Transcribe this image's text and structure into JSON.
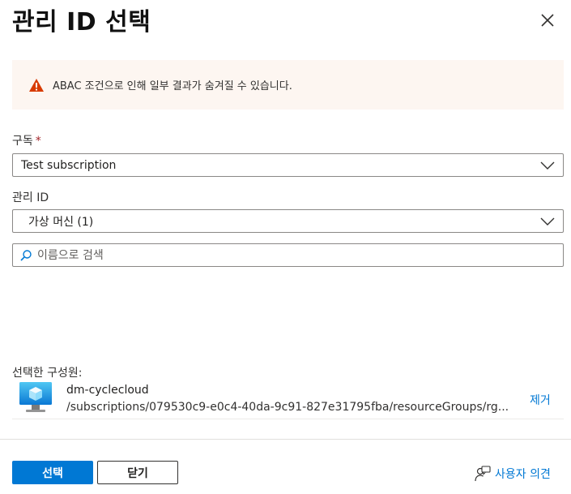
{
  "dialog": {
    "title": "관리 ID 선택",
    "close_icon": "close-icon"
  },
  "warning": {
    "icon": "warning-icon",
    "text": "ABAC 조건으로 인해 일부 결과가 숨겨질 수 있습니다."
  },
  "subscription": {
    "label": "구독",
    "required_mark": "*",
    "value": "Test subscription"
  },
  "managed_id": {
    "label": "관리 ID",
    "value": "가상 머신 (1)"
  },
  "search": {
    "placeholder": "이름으로 검색",
    "value": ""
  },
  "selected_members": {
    "label": "선택한 구성원:",
    "items": [
      {
        "name": "dm-cyclecloud",
        "path": "/subscriptions/079530c9-e0c4-40da-9c91-827e31795fba/resourceGroups/rg...",
        "remove_label": "제거",
        "icon": "virtual-machine-icon"
      }
    ]
  },
  "footer": {
    "select_label": "선택",
    "close_label": "닫기",
    "feedback_label": "사용자 의견",
    "feedback_icon": "feedback-icon"
  },
  "colors": {
    "accent": "#0078d4",
    "warning_bg": "#fdf6f1",
    "warning_icon": "#d83b01",
    "required": "#a4262c"
  }
}
